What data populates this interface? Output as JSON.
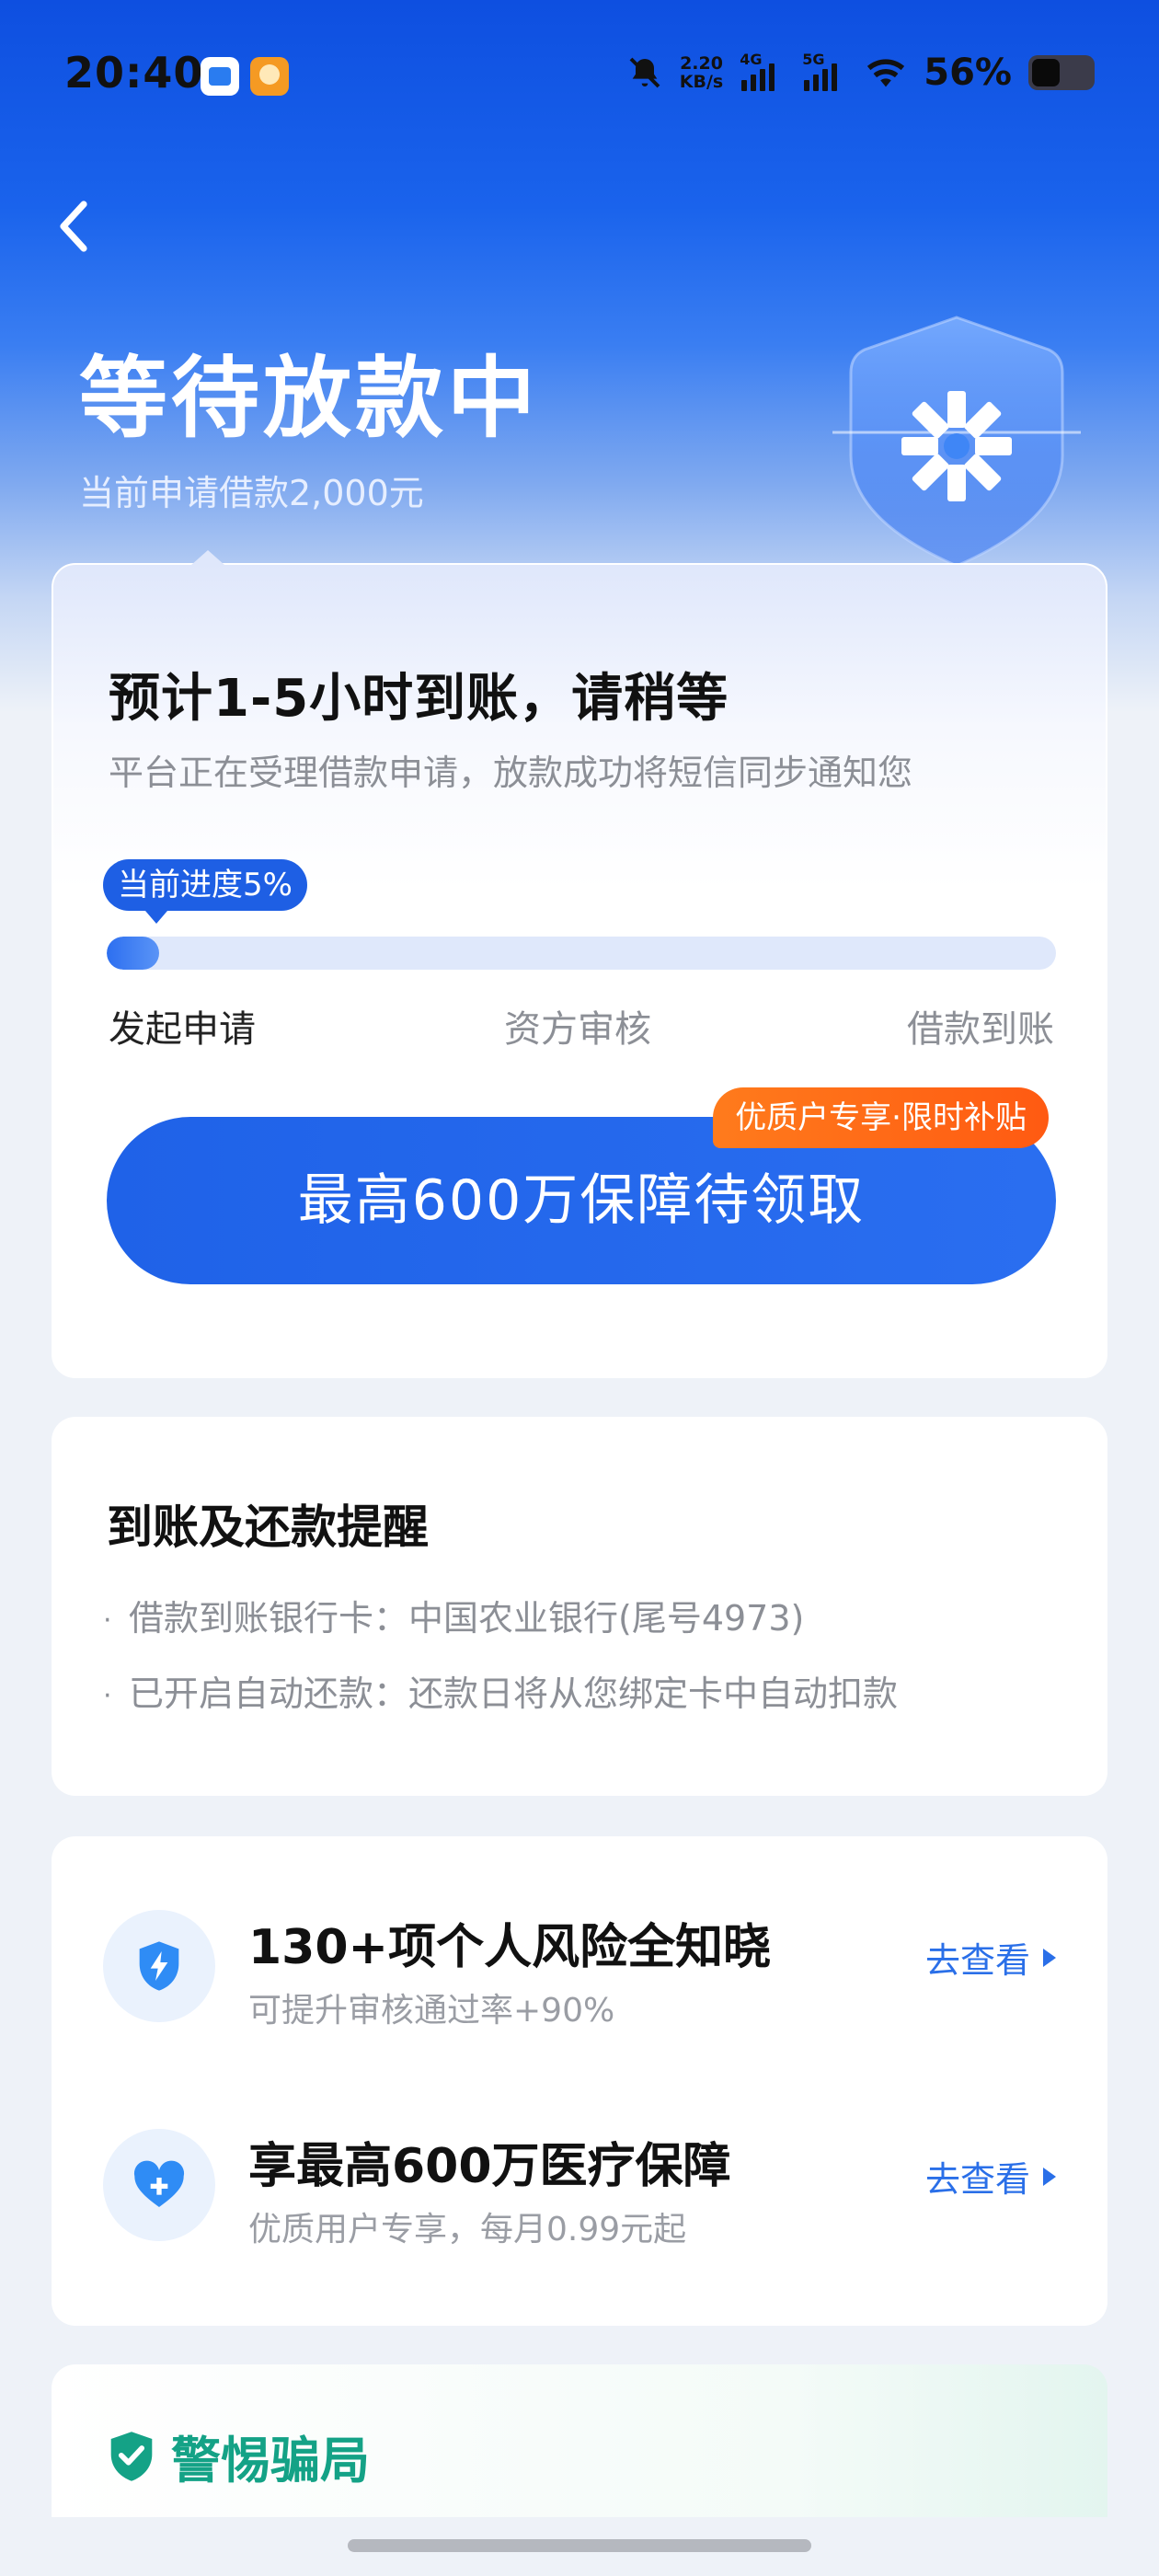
{
  "status_bar": {
    "time": "20:40",
    "speed_value": "2.20",
    "speed_unit": "KB/s",
    "net1": "4G",
    "net2": "5G",
    "battery": "56%",
    "icons": [
      "mute-bell-icon",
      "signal-icon",
      "wifi-icon",
      "battery-icon"
    ]
  },
  "header": {
    "title": "等待放款中",
    "subtitle": "当前申请借款2,000元"
  },
  "status_card": {
    "eta_title": "预计1-5小时到账，请稍等",
    "eta_desc": "平台正在受理借款申请，放款成功将短信同步通知您",
    "progress_badge": "当前进度5%",
    "progress_fraction": 0.05,
    "steps": [
      "发起申请",
      "资方审核",
      "借款到账"
    ],
    "promo_button": "最高600万保障待领取",
    "promo_tag": "优质户专享·限时补贴"
  },
  "reminder_card": {
    "title": "到账及还款提醒",
    "items": [
      "借款到账银行卡：中国农业银行(尾号4973)",
      "已开启自动还款：还款日将从您绑定卡中自动扣款"
    ]
  },
  "services": [
    {
      "title": "130+项个人风险全知晓",
      "subtitle": "可提升审核通过率+90%",
      "link": "去查看",
      "icon": "shield-bolt-icon"
    },
    {
      "title": "享最高600万医疗保障",
      "subtitle": "优质用户专享，每月0.99元起",
      "link": "去查看",
      "icon": "heart-plus-icon"
    }
  ],
  "fraud_card": {
    "title": "警惕骗局",
    "icon": "shield-check-icon"
  },
  "colors": {
    "brand_blue": "#1f62e8",
    "promo_orange": "#ff6a16",
    "fraud_green": "#14a286",
    "link_blue": "#2a6fe8"
  }
}
